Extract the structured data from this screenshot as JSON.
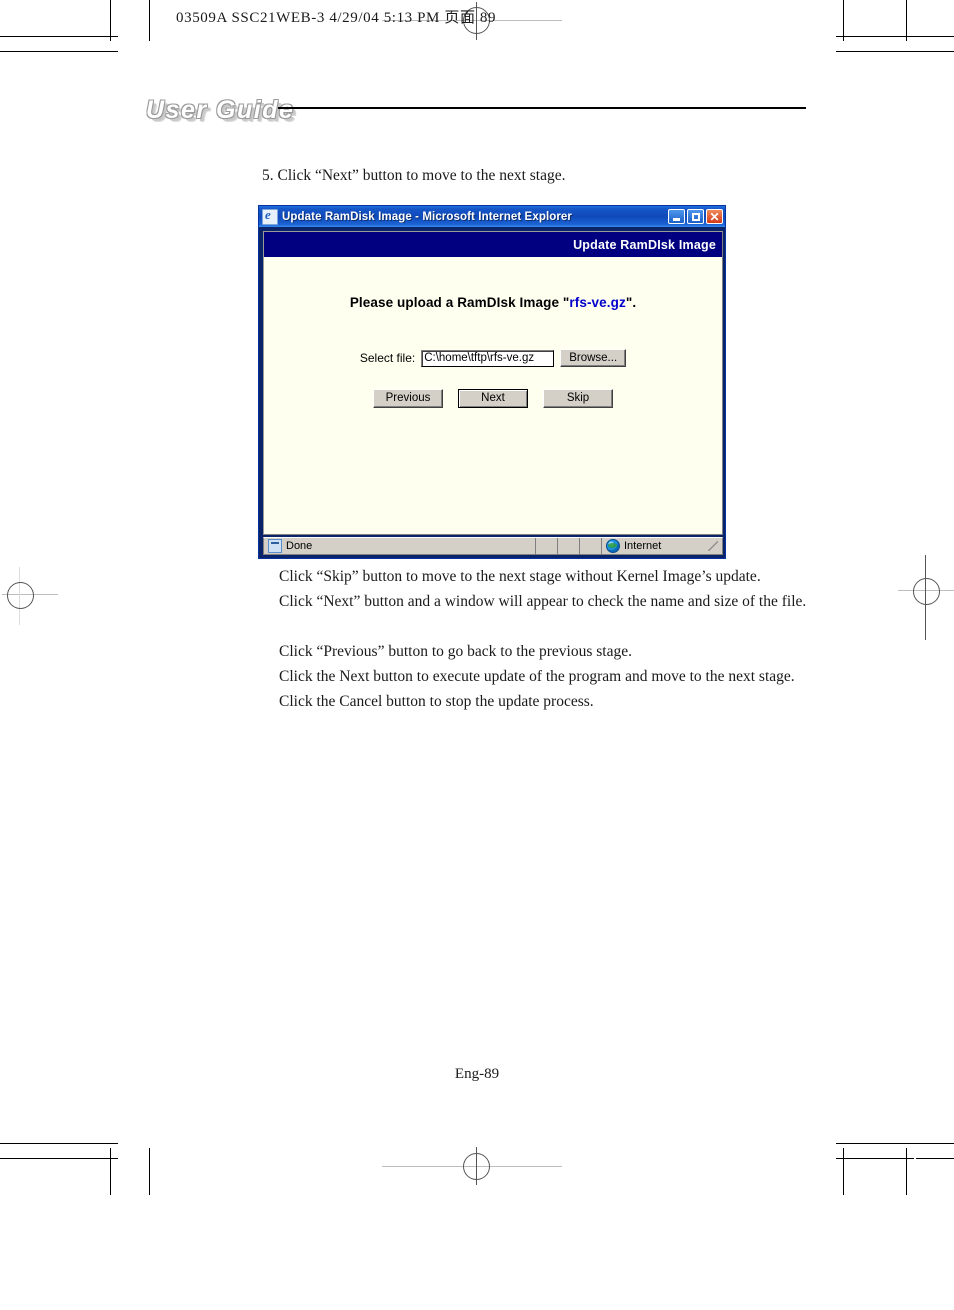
{
  "printer_header": "03509A SSC21WEB-3  4/29/04  5:13 PM  页面 89",
  "guide_banner": "User Guide",
  "step_text": "5. Click “Next” button to move to the next stage.",
  "notes": [
    "Click “Skip” button to move to the next stage without Kernel Image’s update.",
    "Click “Next” button and a window will appear to check the name and size of the file.",
    "Click “Previous” button to go back to the previous stage.",
    "Click the Next button to execute update of the program and move to the next stage.",
    "Click the Cancel button to stop the update process."
  ],
  "footer": "Eng-89",
  "browser_window": {
    "title": "Update RamDisk Image - Microsoft Internet Explorer",
    "app_icon": "internet-explorer-icon",
    "window_buttons": {
      "minimize": "minimize-icon",
      "maximize": "maximize-icon",
      "close": "close-icon"
    },
    "page_band_title": "Update RamDIsk Image",
    "heading_prefix": "Please upload a RamDIsk Image \"",
    "heading_filename": "rfs-ve.gz",
    "heading_suffix": "\".",
    "form": {
      "select_file_label": "Select file:",
      "file_path_value": "C:\\home\\tftp\\rfs-ve.gz",
      "file_path_placeholder": "",
      "browse_label": "Browse...",
      "previous_label": "Previous",
      "next_label": "Next",
      "skip_label": "Skip"
    },
    "status_bar": {
      "status_text": "Done",
      "status_icon": "page-icon",
      "zone_text": "Internet",
      "zone_icon": "globe-icon"
    },
    "colors": {
      "titlebar_blue": "#1657c8",
      "band_navy": "#000080",
      "page_background": "#fffff0",
      "link_blue": "#0000cc",
      "chrome_gray": "#d4d0c8"
    }
  }
}
